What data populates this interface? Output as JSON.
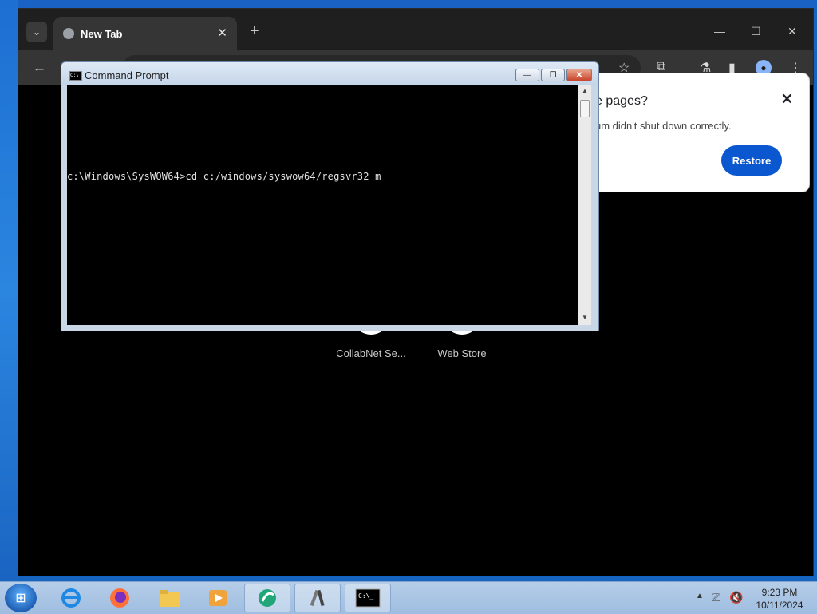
{
  "browser": {
    "tab_title": "New Tab",
    "tab_close": "✕",
    "new_tab": "+",
    "back": "←",
    "minimize": "—",
    "maximize": "☐",
    "close": "✕",
    "toolbar_icons": [
      "star-icon",
      "extensions-icon",
      "labs-icon",
      "sidepanel-icon",
      "profile-icon",
      "menu-icon"
    ]
  },
  "restore_popup": {
    "title": "e pages?",
    "body": "um didn't shut down correctly.",
    "button": "Restore",
    "close": "✕"
  },
  "shortcuts": [
    {
      "label": "CollabNet Se...",
      "icon": "search-icon"
    },
    {
      "label": "Web Store",
      "icon": "webstore-icon"
    }
  ],
  "cmd": {
    "title": "Command Prompt",
    "line": "c:\\Windows\\SysWOW64>cd c:/windows/syswow64/regsvr32 m",
    "minimize": "—",
    "restore": "❐",
    "close": "✕",
    "icon_text": "C:\\"
  },
  "taskbar": {
    "items": [
      "internet-explorer-icon",
      "firefox-icon",
      "file-explorer-icon",
      "media-player-icon",
      "app-icon",
      "tools-icon",
      "command-prompt-icon"
    ],
    "time": "9:23 PM",
    "date": "10/11/2024"
  }
}
